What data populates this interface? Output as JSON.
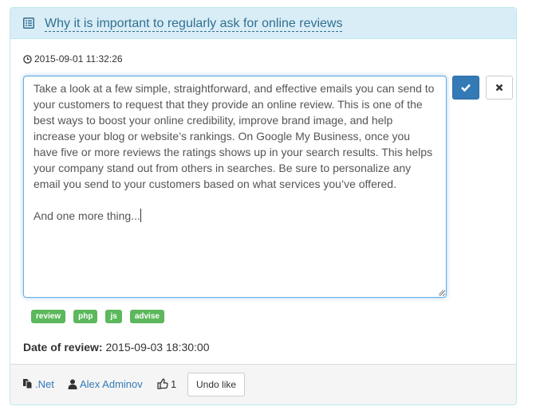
{
  "header": {
    "title": "Why it is important to regularly ask for online reviews",
    "icon": "list-icon"
  },
  "post": {
    "timestamp": "2015-09-01 11:32:26",
    "body_paragraph_1": "Take a look at a few simple, straightforward, and effective emails you can send to your customers to request that they provide an online review. This is one of the best ways to boost your online credibility, improve brand image, and help increase your blog or website’s rankings.  On Google My Business, once you have five or more reviews the ratings shows up in your search results. This helps your company stand out from others in searches. Be sure to personalize any email you send to your customers based on what services you’ve offered.",
    "body_paragraph_2": "And one more thing..."
  },
  "actions": {
    "confirm_icon": "checkmark-icon",
    "cancel_icon": "close-icon"
  },
  "tags": [
    "review",
    "php",
    "js",
    "advise"
  ],
  "review_date": {
    "label": "Date of review:",
    "value": "2015-09-03 18:30:00"
  },
  "footer": {
    "category": ".Net",
    "author": "Alex Adminov",
    "likes": "1",
    "undo_like_label": "Undo like"
  },
  "colors": {
    "heading_bg": "#d9edf7",
    "heading_text": "#31708f",
    "primary": "#337ab7",
    "tag_bg": "#5cb85c"
  }
}
